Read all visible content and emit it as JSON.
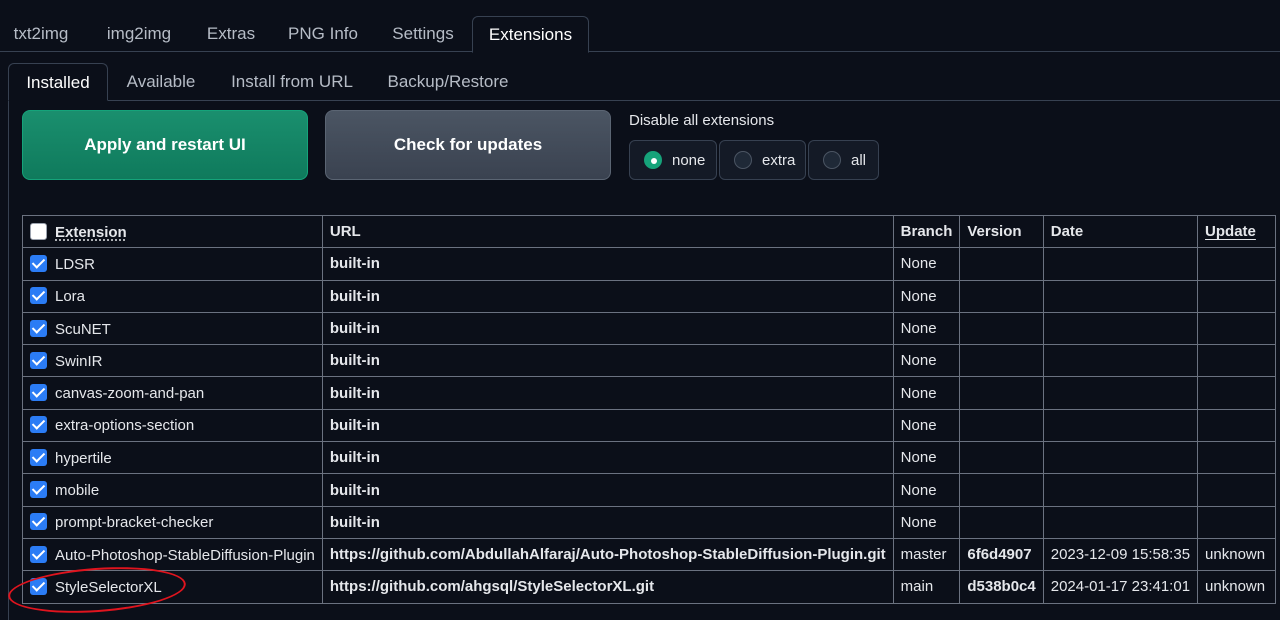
{
  "top_tabs": [
    {
      "label": "txt2img",
      "active": false
    },
    {
      "label": "img2img",
      "active": false
    },
    {
      "label": "Extras",
      "active": false
    },
    {
      "label": "PNG Info",
      "active": false
    },
    {
      "label": "Settings",
      "active": false
    },
    {
      "label": "Extensions",
      "active": true
    }
  ],
  "sub_tabs": [
    {
      "label": "Installed",
      "active": true
    },
    {
      "label": "Available",
      "active": false
    },
    {
      "label": "Install from URL",
      "active": false
    },
    {
      "label": "Backup/Restore",
      "active": false
    }
  ],
  "buttons": {
    "apply": "Apply and restart UI",
    "check": "Check for updates"
  },
  "disable": {
    "label": "Disable all extensions",
    "options": [
      "none",
      "extra",
      "all"
    ],
    "selected": "none"
  },
  "table": {
    "headers": [
      "Extension",
      "URL",
      "Branch",
      "Version",
      "Date",
      "Update"
    ],
    "rows": [
      {
        "name": "LDSR",
        "url": "built-in",
        "branch": "None",
        "version": "",
        "date": "",
        "update": "",
        "checked": true
      },
      {
        "name": "Lora",
        "url": "built-in",
        "branch": "None",
        "version": "",
        "date": "",
        "update": "",
        "checked": true
      },
      {
        "name": "ScuNET",
        "url": "built-in",
        "branch": "None",
        "version": "",
        "date": "",
        "update": "",
        "checked": true
      },
      {
        "name": "SwinIR",
        "url": "built-in",
        "branch": "None",
        "version": "",
        "date": "",
        "update": "",
        "checked": true
      },
      {
        "name": "canvas-zoom-and-pan",
        "url": "built-in",
        "branch": "None",
        "version": "",
        "date": "",
        "update": "",
        "checked": true
      },
      {
        "name": "extra-options-section",
        "url": "built-in",
        "branch": "None",
        "version": "",
        "date": "",
        "update": "",
        "checked": true
      },
      {
        "name": "hypertile",
        "url": "built-in",
        "branch": "None",
        "version": "",
        "date": "",
        "update": "",
        "checked": true
      },
      {
        "name": "mobile",
        "url": "built-in",
        "branch": "None",
        "version": "",
        "date": "",
        "update": "",
        "checked": true
      },
      {
        "name": "prompt-bracket-checker",
        "url": "built-in",
        "branch": "None",
        "version": "",
        "date": "",
        "update": "",
        "checked": true
      },
      {
        "name": "Auto-Photoshop-StableDiffusion-Plugin",
        "url": "https://github.com/AbdullahAlfaraj/Auto-Photoshop-StableDiffusion-Plugin.git",
        "branch": "master",
        "version": "6f6d4907",
        "date": "2023-12-09 15:58:35",
        "update": "unknown",
        "checked": true
      },
      {
        "name": "StyleSelectorXL",
        "url": "https://github.com/ahgsql/StyleSelectorXL.git",
        "branch": "main",
        "version": "d538b0c4",
        "date": "2024-01-17 23:41:01",
        "update": "unknown",
        "checked": true
      }
    ]
  }
}
